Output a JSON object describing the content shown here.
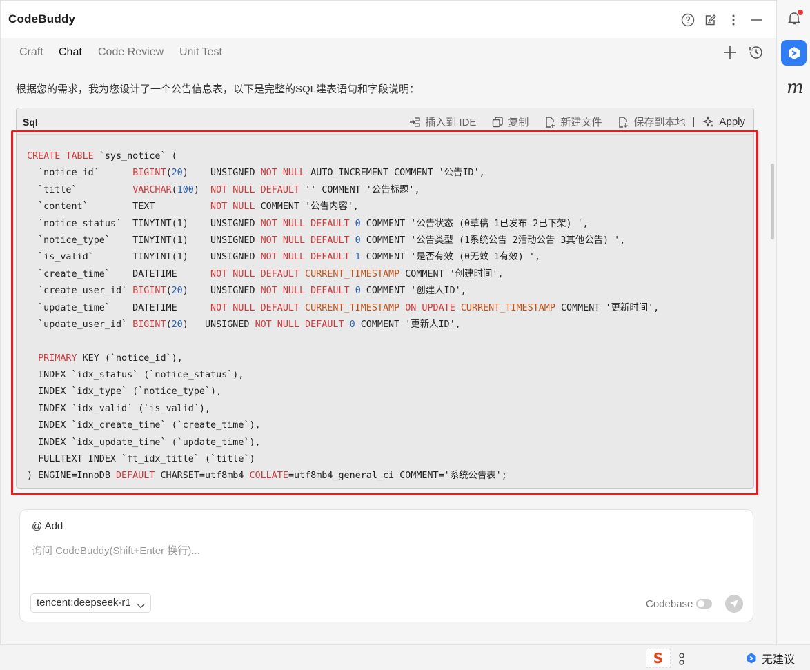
{
  "app": {
    "title": "CodeBuddy"
  },
  "tabs": [
    {
      "label": "Craft"
    },
    {
      "label": "Chat"
    },
    {
      "label": "Code Review"
    },
    {
      "label": "Unit Test"
    }
  ],
  "intro_text": "根据您的需求，我为您设计了一个公告信息表，以下是完整的SQL建表语句和字段说明：",
  "code_block": {
    "language": "Sql",
    "tools": {
      "insert_ide": "插入到 IDE",
      "copy": "复制",
      "new_file": "新建文件",
      "save_local": "保存到本地",
      "apply": "Apply"
    }
  },
  "code_lines": [
    [
      {
        "t": "CREATE TABLE",
        "c": "kw"
      },
      {
        "t": " `sys_notice` (",
        "c": ""
      }
    ],
    [
      {
        "t": "  `notice_id`      ",
        "c": ""
      },
      {
        "t": "BIGINT",
        "c": "kw"
      },
      {
        "t": "(",
        "c": ""
      },
      {
        "t": "20",
        "c": "num"
      },
      {
        "t": ")    UNSIGNED ",
        "c": ""
      },
      {
        "t": "NOT NULL",
        "c": "kw"
      },
      {
        "t": " AUTO_INCREMENT COMMENT '公告ID',",
        "c": ""
      }
    ],
    [
      {
        "t": "  `title`          ",
        "c": ""
      },
      {
        "t": "VARCHAR",
        "c": "kw"
      },
      {
        "t": "(",
        "c": ""
      },
      {
        "t": "100",
        "c": "num"
      },
      {
        "t": ")  ",
        "c": ""
      },
      {
        "t": "NOT NULL DEFAULT",
        "c": "kw"
      },
      {
        "t": " '' COMMENT '公告标题',",
        "c": ""
      }
    ],
    [
      {
        "t": "  `content`        TEXT          ",
        "c": ""
      },
      {
        "t": "NOT NULL",
        "c": "kw"
      },
      {
        "t": " COMMENT '公告内容',",
        "c": ""
      }
    ],
    [
      {
        "t": "  `notice_status`  TINYINT(1)    UNSIGNED ",
        "c": ""
      },
      {
        "t": "NOT NULL DEFAULT",
        "c": "kw"
      },
      {
        "t": " ",
        "c": ""
      },
      {
        "t": "0",
        "c": "num"
      },
      {
        "t": " COMMENT '公告状态 (0草稿 1已发布 2已下架) ',",
        "c": ""
      }
    ],
    [
      {
        "t": "  `notice_type`    TINYINT(1)    UNSIGNED ",
        "c": ""
      },
      {
        "t": "NOT NULL DEFAULT",
        "c": "kw"
      },
      {
        "t": " ",
        "c": ""
      },
      {
        "t": "0",
        "c": "num"
      },
      {
        "t": " COMMENT '公告类型 (1系统公告 2活动公告 3其他公告) ',",
        "c": ""
      }
    ],
    [
      {
        "t": "  `is_valid`       TINYINT(1)    UNSIGNED ",
        "c": ""
      },
      {
        "t": "NOT NULL DEFAULT",
        "c": "kw"
      },
      {
        "t": " ",
        "c": ""
      },
      {
        "t": "1",
        "c": "num"
      },
      {
        "t": " COMMENT '是否有效 (0无效 1有效) ',",
        "c": ""
      }
    ],
    [
      {
        "t": "  `create_time`    DATETIME      ",
        "c": ""
      },
      {
        "t": "NOT NULL DEFAULT",
        "c": "kw"
      },
      {
        "t": " ",
        "c": ""
      },
      {
        "t": "CURRENT_TIMESTAMP",
        "c": "fn"
      },
      {
        "t": " COMMENT '创建时间',",
        "c": ""
      }
    ],
    [
      {
        "t": "  `create_user_id` ",
        "c": ""
      },
      {
        "t": "BIGINT",
        "c": "kw"
      },
      {
        "t": "(",
        "c": ""
      },
      {
        "t": "20",
        "c": "num"
      },
      {
        "t": ")    UNSIGNED ",
        "c": ""
      },
      {
        "t": "NOT NULL DEFAULT",
        "c": "kw"
      },
      {
        "t": " ",
        "c": ""
      },
      {
        "t": "0",
        "c": "num"
      },
      {
        "t": " COMMENT '创建人ID',",
        "c": ""
      }
    ],
    [
      {
        "t": "  `update_time`    DATETIME      ",
        "c": ""
      },
      {
        "t": "NOT NULL DEFAULT",
        "c": "kw"
      },
      {
        "t": " ",
        "c": ""
      },
      {
        "t": "CURRENT_TIMESTAMP",
        "c": "fn"
      },
      {
        "t": " ",
        "c": ""
      },
      {
        "t": "ON UPDATE",
        "c": "kw"
      },
      {
        "t": " ",
        "c": ""
      },
      {
        "t": "CURRENT_TIMESTAMP",
        "c": "fn"
      },
      {
        "t": " COMMENT '更新时间',",
        "c": ""
      }
    ],
    [
      {
        "t": "  `update_user_id` ",
        "c": ""
      },
      {
        "t": "BIGINT",
        "c": "kw"
      },
      {
        "t": "(",
        "c": ""
      },
      {
        "t": "20",
        "c": "num"
      },
      {
        "t": ")   UNSIGNED ",
        "c": ""
      },
      {
        "t": "NOT NULL DEFAULT",
        "c": "kw"
      },
      {
        "t": " ",
        "c": ""
      },
      {
        "t": "0",
        "c": "num"
      },
      {
        "t": " COMMENT '更新人ID',",
        "c": ""
      }
    ],
    [
      {
        "t": "",
        "c": ""
      }
    ],
    [
      {
        "t": "  ",
        "c": ""
      },
      {
        "t": "PRIMARY",
        "c": "kw"
      },
      {
        "t": " KEY (`notice_id`),",
        "c": ""
      }
    ],
    [
      {
        "t": "  INDEX `idx_status` (`notice_status`),",
        "c": ""
      }
    ],
    [
      {
        "t": "  INDEX `idx_type` (`notice_type`),",
        "c": ""
      }
    ],
    [
      {
        "t": "  INDEX `idx_valid` (`is_valid`),",
        "c": ""
      }
    ],
    [
      {
        "t": "  INDEX `idx_create_time` (`create_time`),",
        "c": ""
      }
    ],
    [
      {
        "t": "  INDEX `idx_update_time` (`update_time`),",
        "c": ""
      }
    ],
    [
      {
        "t": "  FULLTEXT INDEX `ft_idx_title` (`title`)",
        "c": ""
      }
    ],
    [
      {
        "t": ") ENGINE=InnoDB ",
        "c": ""
      },
      {
        "t": "DEFAULT",
        "c": "kw"
      },
      {
        "t": " CHARSET=utf8mb4 ",
        "c": ""
      },
      {
        "t": "COLLATE",
        "c": "kw"
      },
      {
        "t": "=utf8mb4_general_ci COMMENT='系统公告表';",
        "c": ""
      }
    ]
  ],
  "composer": {
    "add_label": "@ Add",
    "placeholder": "询问 CodeBuddy(Shift+Enter 换行)...",
    "model": "tencent:deepseek-r1",
    "codebase_label": "Codebase",
    "codebase_enabled": false
  },
  "statusbar": {
    "ime_glyph": "S",
    "suggestion": "无建议"
  },
  "colors": {
    "keyword": "#d03a3a",
    "function": "#c2541a",
    "number": "#2a63b0",
    "highlight_frame": "#f01818",
    "brand": "#2f7df5"
  }
}
